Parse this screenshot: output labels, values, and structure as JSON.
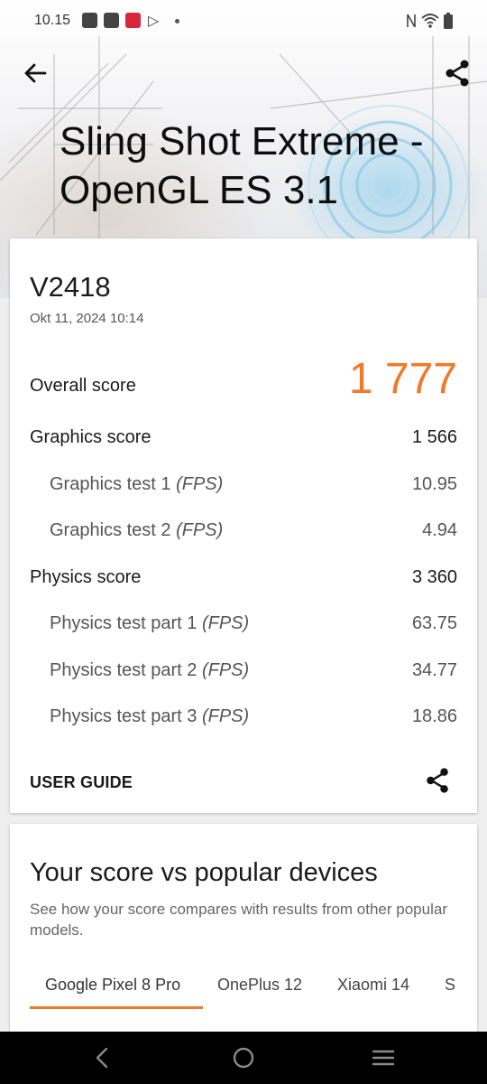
{
  "status_bar": {
    "time": "10.15"
  },
  "header": {
    "title_line1": "Sling Shot Extreme -",
    "title_line2": "OpenGL ES 3.1"
  },
  "result": {
    "device": "V2418",
    "date": "Okt 11, 2024 10:14",
    "overall_label": "Overall score",
    "overall_value": "1 777",
    "rows": [
      {
        "label": "Graphics score",
        "unit": "",
        "value": "1 566"
      },
      {
        "label": "Graphics test 1 ",
        "unit": "(FPS)",
        "value": "10.95"
      },
      {
        "label": "Graphics test 2 ",
        "unit": "(FPS)",
        "value": "4.94"
      },
      {
        "label": "Physics score",
        "unit": "",
        "value": "3 360"
      },
      {
        "label": "Physics test part 1 ",
        "unit": "(FPS)",
        "value": "63.75"
      },
      {
        "label": "Physics test part 2 ",
        "unit": "(FPS)",
        "value": "34.77"
      },
      {
        "label": "Physics test part 3 ",
        "unit": "(FPS)",
        "value": "18.86"
      }
    ],
    "user_guide": "USER GUIDE"
  },
  "compare": {
    "title": "Your score vs popular devices",
    "description": "See how your score compares with results from other popular models.",
    "tabs": [
      "Google Pixel 8 Pro",
      "OnePlus 12",
      "Xiaomi 14",
      "S"
    ]
  },
  "icons": {
    "back": "arrow-left-icon",
    "share": "share-icon",
    "nav_back": "chevron-left-icon",
    "nav_home": "circle-home-icon",
    "nav_menu": "menu-lines-icon"
  },
  "colors": {
    "accent": "#ee7a2a",
    "card": "#ffffff",
    "navbar": "#000000"
  }
}
